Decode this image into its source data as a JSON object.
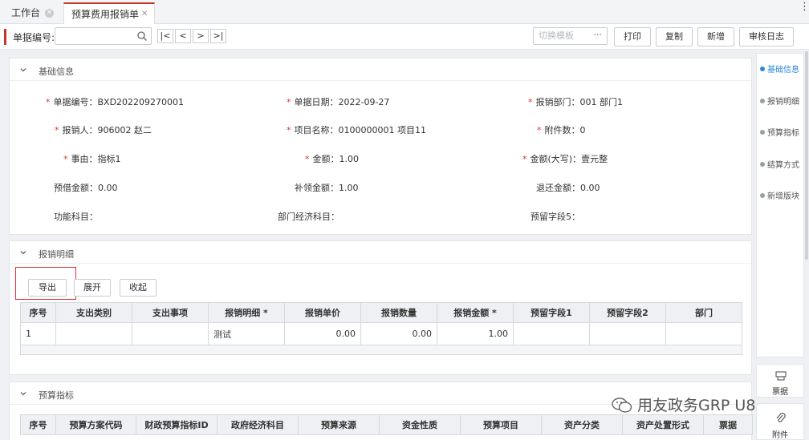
{
  "tabs": [
    {
      "label": "工作台"
    },
    {
      "label": "预算费用报销单"
    }
  ],
  "toolbar": {
    "billno_label": "单据编号:",
    "billno_value": "",
    "template_placeholder": "切换模板",
    "nav": [
      "|<",
      "<",
      ">",
      ">|"
    ],
    "buttons": [
      "打印",
      "复制",
      "新增",
      "审核日志"
    ]
  },
  "basic": {
    "title": "基础信息",
    "fields": {
      "bill_no": "单据编号：BXD202209270001",
      "bill_date": "单据日期：2022-09-27",
      "dept": "报销部门：001 部门1",
      "claimant": "报销人：906002 赵二",
      "project": "项目名称：0100000001 项目11",
      "attachments": "附件数：0",
      "reason": "事由：指标1",
      "amount": "金额：1.00",
      "amount_caps": "金额(大写)：壹元整",
      "advance": "预借金额：0.00",
      "supplement": "补领金额：1.00",
      "refund": "退还金额：0.00",
      "func_subject": "功能科目：",
      "dept_econ": "部门经济科目：",
      "reserve5": "预留字段5："
    }
  },
  "detail": {
    "title": "报销明细",
    "buttons": [
      "导出",
      "展开",
      "收起"
    ],
    "columns": [
      "序号",
      "支出类别",
      "支出事项",
      "报销明细 *",
      "报销单价",
      "报销数量",
      "报销金额 *",
      "预留字段1",
      "预留字段2",
      "部门"
    ],
    "rows": [
      [
        "1",
        "",
        "",
        "测试",
        "0.00",
        "0.00",
        "1.00",
        "",
        "",
        ""
      ]
    ]
  },
  "budget": {
    "title": "预算指标",
    "columns": [
      "序号",
      "预算方案代码",
      "财政预算指标ID",
      "政府经济科目",
      "预算来源",
      "资金性质",
      "预算项目",
      "资产分类",
      "资产处置形式",
      "票据"
    ]
  },
  "right_nav": {
    "items": [
      "基础信息",
      "报销明细",
      "预算指标",
      "结算方式",
      "新增版块"
    ],
    "active": 0,
    "side": [
      "票据",
      "附件"
    ]
  },
  "watermark": "用友政务GRP U8",
  "colors": {
    "accent": "#c0392b",
    "active_nav": "#2b88d8",
    "header_bg": "#eef0f3"
  }
}
